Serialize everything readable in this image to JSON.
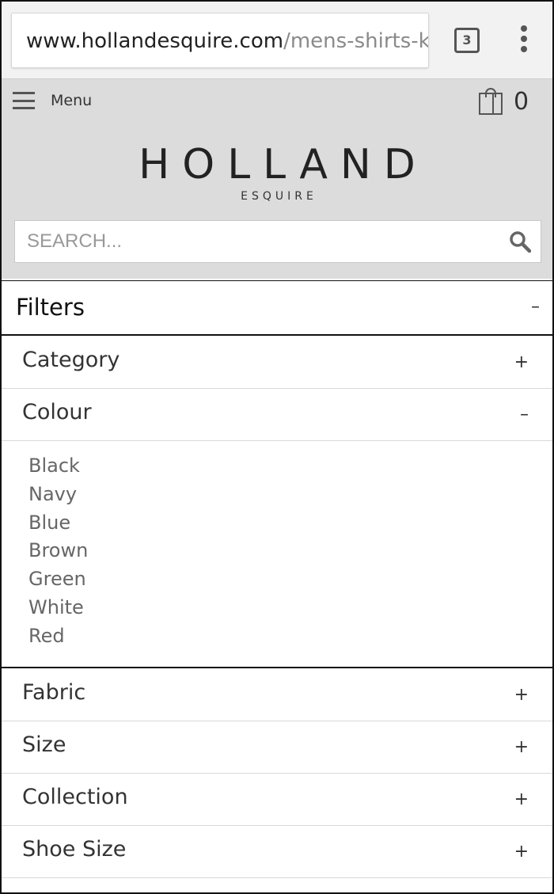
{
  "browser": {
    "url_host": "www.hollandesquire.com",
    "url_path": "/mens-shirts-kr",
    "tab_count": "3"
  },
  "header": {
    "menu_label": "Menu",
    "cart_count": "0",
    "logo_main": "HOLLAND",
    "logo_sub": "ESQUIRE",
    "search_placeholder": "SEARCH..."
  },
  "filters": {
    "title": "Filters",
    "title_toggle": "–",
    "sections": [
      {
        "label": "Category",
        "toggle": "+"
      },
      {
        "label": "Colour",
        "toggle": "–"
      },
      {
        "label": "Fabric",
        "toggle": "+"
      },
      {
        "label": "Size",
        "toggle": "+"
      },
      {
        "label": "Collection",
        "toggle": "+"
      },
      {
        "label": "Shoe Size",
        "toggle": "+"
      }
    ],
    "colours": [
      "Black",
      "Navy",
      "Blue",
      "Brown",
      "Green",
      "White",
      "Red"
    ]
  },
  "icons": {
    "menu": "hamburger-icon",
    "cart": "shopping-bag-icon",
    "search": "search-icon",
    "tabs": "tab-switcher-icon",
    "overflow": "more-vert-icon"
  }
}
